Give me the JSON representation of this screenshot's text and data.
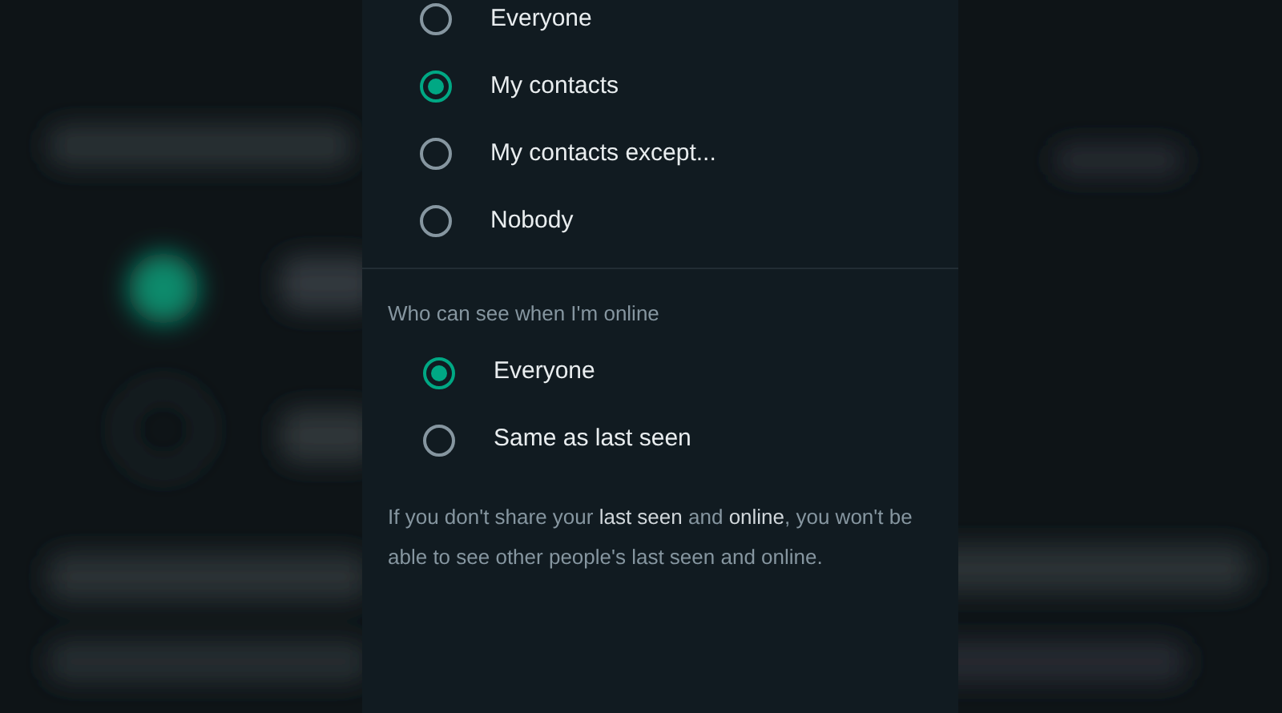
{
  "last_seen": {
    "options": [
      {
        "label": "Everyone",
        "selected": false
      },
      {
        "label": "My contacts",
        "selected": true
      },
      {
        "label": "My contacts except...",
        "selected": false
      },
      {
        "label": "Nobody",
        "selected": false
      }
    ]
  },
  "online": {
    "title": "Who can see when I'm online",
    "options": [
      {
        "label": "Everyone",
        "selected": true
      },
      {
        "label": "Same as last seen",
        "selected": false
      }
    ]
  },
  "note": "If you don't share your **last seen** and **online**, you won't be able to see other people's last seen and online."
}
